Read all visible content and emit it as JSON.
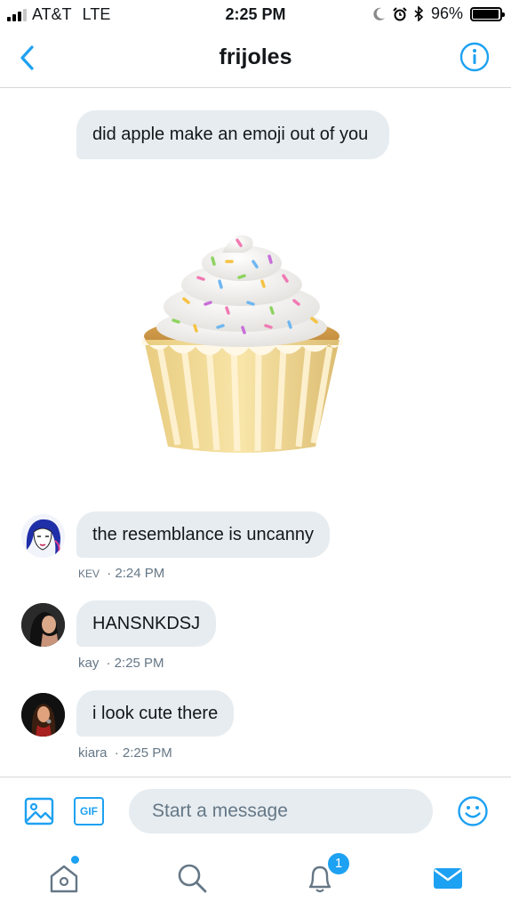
{
  "status_bar": {
    "carrier": "AT&T",
    "network": "LTE",
    "time": "2:25 PM",
    "battery": "96%",
    "battery_level": 0.96,
    "icons": [
      "moon-icon",
      "alarm-icon",
      "bluetooth-icon"
    ]
  },
  "header": {
    "title": "frijoles",
    "back_icon": "chevron-left-icon",
    "info_icon": "info-icon"
  },
  "messages": [
    {
      "text": "did apple make an emoji out of you"
    },
    {
      "image": "cupcake-emoji"
    },
    {
      "text": "the resemblance is uncanny",
      "sender": "KEV",
      "time": "· 2:24 PM"
    },
    {
      "text": "HANSNKDSJ",
      "sender": "kay",
      "time": "· 2:25 PM"
    },
    {
      "text": "i look cute there",
      "sender": "kiara",
      "time": "· 2:25 PM"
    }
  ],
  "composer": {
    "placeholder": "Start a message",
    "gif_label": "GIF"
  },
  "tabbar": {
    "notifications_badge": "1",
    "items": [
      "home-icon",
      "search-icon",
      "notifications-icon",
      "messages-icon"
    ]
  },
  "colors": {
    "accent": "#1da1f2",
    "bubble": "#e6ecf0",
    "meta_text": "#657786"
  }
}
